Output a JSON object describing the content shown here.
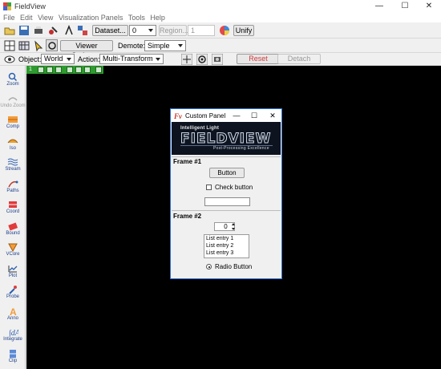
{
  "window": {
    "title": "FieldView",
    "min": "—",
    "max": "☐",
    "close": "✕"
  },
  "menu": [
    "File",
    "Edit",
    "View",
    "Visualization Panels",
    "Tools",
    "Help"
  ],
  "toolbar1": {
    "dataset_label": "Dataset...",
    "dataset_value": "0",
    "region_label": "Region...",
    "region_value": "1",
    "unify_label": "Unify"
  },
  "toolbar2": {
    "viewer_options_label": "Viewer Options...",
    "demote_label": "Demote:",
    "demote_value": "Simple"
  },
  "toolbar3": {
    "object_label": "Object:",
    "object_value": "World",
    "action_label": "Action:",
    "action_value": "Multi-Transform",
    "reset_label": "Reset",
    "detach_label": "Detach",
    "reset_color": "#d23a3a"
  },
  "sidebar": [
    {
      "label": "Zoom",
      "icon": "zoom-icon",
      "enabled": true
    },
    {
      "label": "Undo Zoom",
      "icon": "undo-zoom-icon",
      "enabled": false
    },
    {
      "label": "Comp",
      "icon": "comp-icon",
      "enabled": true
    },
    {
      "label": "Iso",
      "icon": "iso-icon",
      "enabled": true
    },
    {
      "label": "Stream",
      "icon": "stream-icon",
      "enabled": true
    },
    {
      "label": "Paths",
      "icon": "paths-icon",
      "enabled": true
    },
    {
      "label": "Coord",
      "icon": "coord-icon",
      "enabled": true
    },
    {
      "label": "Bound",
      "icon": "bound-icon",
      "enabled": true
    },
    {
      "label": "VCore",
      "icon": "vcore-icon",
      "enabled": true
    },
    {
      "label": "Plot",
      "icon": "plot-icon",
      "enabled": true
    },
    {
      "label": "Probe",
      "icon": "probe-icon",
      "enabled": true
    },
    {
      "label": "Anno",
      "icon": "anno-icon",
      "enabled": true
    },
    {
      "label": "Integrate",
      "icon": "integrate-icon",
      "enabled": true
    },
    {
      "label": "Clip",
      "icon": "clip-icon",
      "enabled": true
    }
  ],
  "viewer_tab": "1",
  "custom_panel": {
    "title": "Custom Panel",
    "banner": {
      "company": "Intelligent Light",
      "product": "FIELDVIEW",
      "tagline": "Post-Processing Excellence"
    },
    "frame1": {
      "heading": "Frame #1",
      "button_label": "Button",
      "check_label": "Check button",
      "text_value": ""
    },
    "frame2": {
      "heading": "Frame #2",
      "spin_value": "0",
      "list": [
        "List entry 1",
        "List entry 2",
        "List entry 3"
      ],
      "radio_label": "Radio Button"
    }
  }
}
